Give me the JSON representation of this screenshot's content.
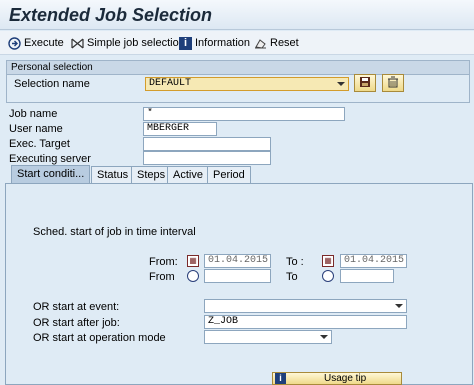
{
  "window": {
    "title": "Extended Job Selection"
  },
  "toolbar": {
    "execute": "Execute",
    "simple_job_selection": "Simple job selection",
    "information": "Information",
    "reset": "Reset"
  },
  "personal_selection": {
    "heading": "Personal selection",
    "selection_name_label": "Selection name",
    "selection_name_value": "DEFAULT"
  },
  "criteria": {
    "job_name_label": "Job name",
    "job_name_value": "*",
    "user_name_label": "User name",
    "user_name_value": "MBERGER",
    "exec_target_label": "Exec. Target",
    "exec_target_value": "",
    "executing_server_label": "Executing server",
    "executing_server_value": ""
  },
  "tabs": [
    {
      "label": "Start conditi..."
    },
    {
      "label": "Status"
    },
    {
      "label": "Steps"
    },
    {
      "label": "Active"
    },
    {
      "label": "Period"
    }
  ],
  "start_conditions": {
    "interval_text": "Sched. start of job in time interval",
    "from_label_1": "From:",
    "from_date": "01.04.2015",
    "to_label_1": "To :",
    "to_date": "01.04.2015",
    "from_label_2": "From",
    "from_time": "",
    "to_label_2": "To",
    "to_time": "",
    "event_label": "OR start at event:",
    "event_value": "",
    "after_job_label": "OR start after job:",
    "after_job_value": "Z_JOB",
    "op_mode_label": "OR start at operation mode",
    "op_mode_value": "",
    "usage_tip": "Usage tip"
  },
  "colors": {
    "background": "#dfebf5",
    "highlight_field": "#f6e9b4",
    "accent_border": "#d39c2c"
  },
  "icons": [
    "execute-icon",
    "simple-selection-icon",
    "information-icon",
    "reset-icon",
    "save-icon",
    "delete-icon",
    "calendar-icon",
    "clock-icon"
  ]
}
